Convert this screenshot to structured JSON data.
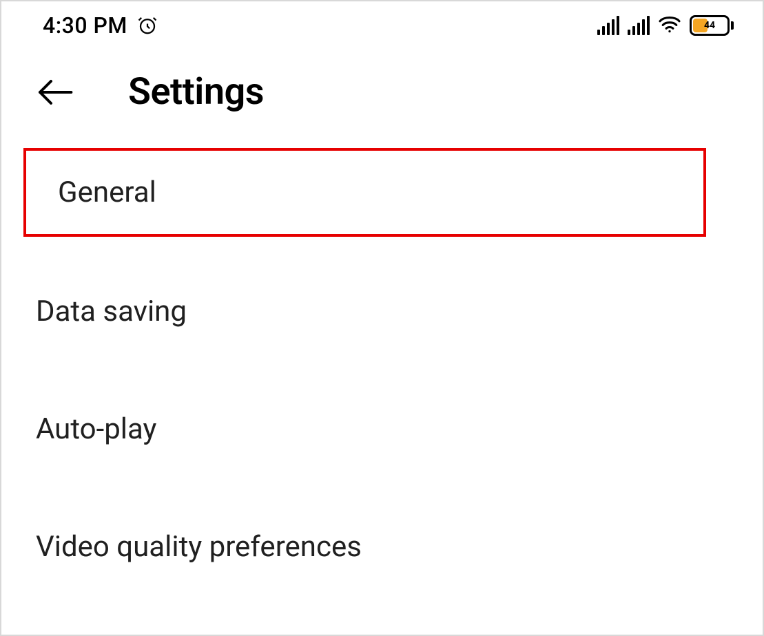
{
  "status_bar": {
    "time": "4:30 PM",
    "battery_percent": "44"
  },
  "header": {
    "title": "Settings"
  },
  "settings": {
    "items": [
      {
        "label": "General",
        "highlighted": true
      },
      {
        "label": "Data saving",
        "highlighted": false
      },
      {
        "label": "Auto-play",
        "highlighted": false
      },
      {
        "label": "Video quality preferences",
        "highlighted": false
      }
    ]
  },
  "colors": {
    "highlight_border": "#e60000",
    "battery_fill": "#f5a623"
  }
}
